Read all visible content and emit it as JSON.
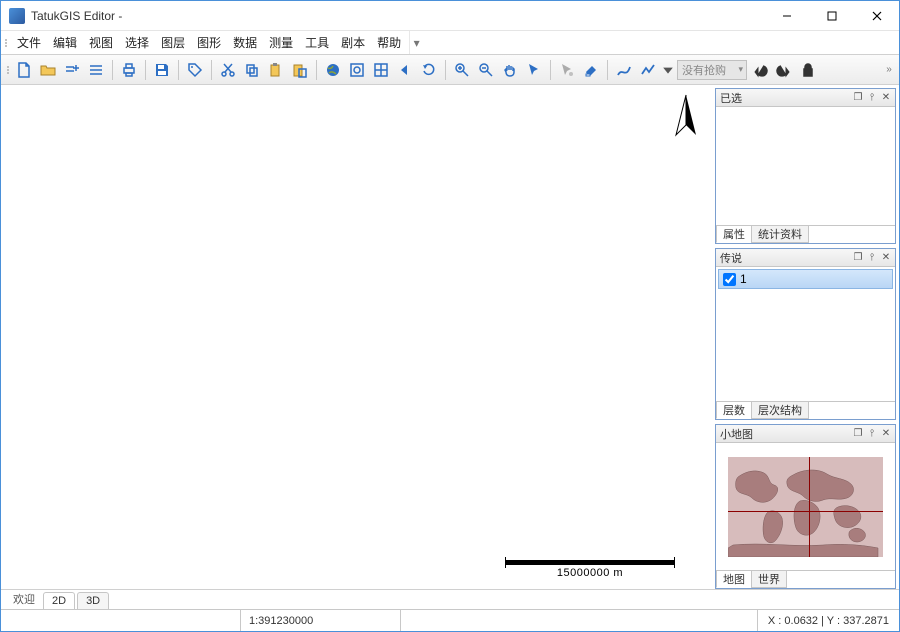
{
  "window": {
    "title": "TatukGIS Editor -"
  },
  "menu": [
    "文件",
    "编辑",
    "视图",
    "选择",
    "图层",
    "图形",
    "数据",
    "测量",
    "工具",
    "剧本",
    "帮助"
  ],
  "toolbar": {
    "comboPlaceholder": "没有抢购"
  },
  "panels": {
    "selected": {
      "title": "已选",
      "tabs": [
        "属性",
        "统计资料"
      ]
    },
    "legend": {
      "title": "传说",
      "item": "1",
      "tabs": [
        "层数",
        "层次结构"
      ]
    },
    "minimap": {
      "title": "小地图",
      "tabs": [
        "地图",
        "世界"
      ]
    }
  },
  "map": {
    "scale_label": "15000000 m"
  },
  "bottom_tabs": {
    "label": "欢迎",
    "tabs": [
      "2D",
      "3D"
    ]
  },
  "status": {
    "scale": "1:391230000",
    "coords": "X : 0.0632 | Y : 337.2871"
  }
}
